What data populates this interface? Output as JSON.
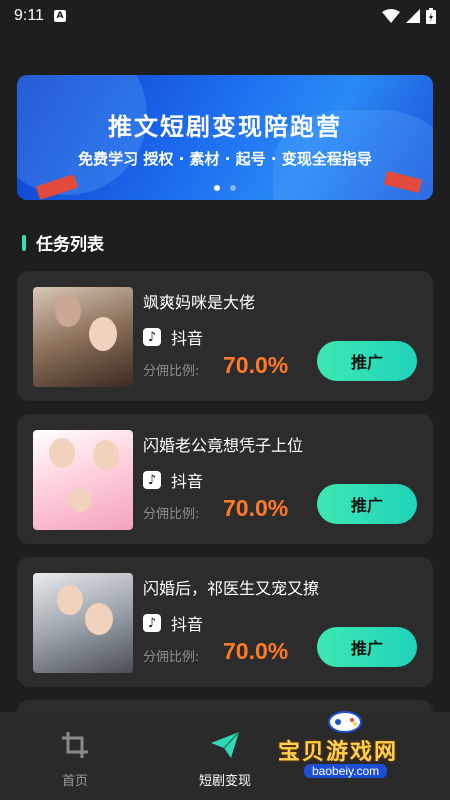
{
  "status_bar": {
    "time": "9:11",
    "notification_icon": "A"
  },
  "banner": {
    "title": "推文短剧变现陪跑营",
    "subtitle": "免费学习 授权 · 素材 · 起号 · 变现全程指导",
    "page_count": 2,
    "active_page": 1
  },
  "section": {
    "title": "任务列表",
    "accent_color": "#33e0b6"
  },
  "tasks": [
    {
      "title": "飒爽妈咪是大佬",
      "platform": "抖音",
      "ratio_label": "分佣比例:",
      "ratio_value": "70.0%",
      "button": "推广",
      "cover_icon": "drama-poster-1"
    },
    {
      "title": "闪婚老公竟想凭子上位",
      "platform": "抖音",
      "ratio_label": "分佣比例:",
      "ratio_value": "70.0%",
      "button": "推广",
      "cover_icon": "drama-poster-2"
    },
    {
      "title": "闪婚后，祁医生又宠又撩",
      "platform": "抖音",
      "ratio_label": "分佣比例:",
      "ratio_value": "70.0%",
      "button": "推广",
      "cover_icon": "drama-poster-3"
    }
  ],
  "bottom_nav": [
    {
      "label": "首页",
      "icon": "crop-icon",
      "active": false
    },
    {
      "label": "短剧变现",
      "icon": "paper-plane-icon",
      "active": true
    }
  ],
  "watermark": {
    "text": "宝贝游戏网",
    "url": "baobeiy.com"
  },
  "colors": {
    "accent": "#33e0b6",
    "ratio": "#ff7a26",
    "card": "#2c2c2c",
    "background": "#1e1e1e"
  }
}
